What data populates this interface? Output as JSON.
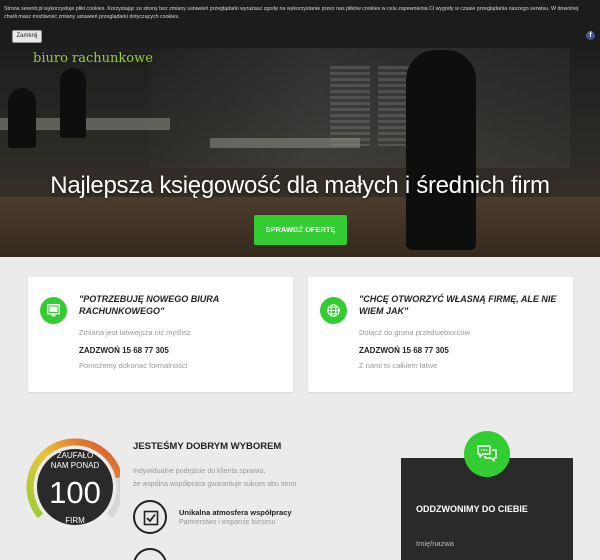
{
  "cookie": {
    "text": "Strona serenit.pl wykorzystuje pliki cookies. Korzystając ze strony bez zmiany ustawień przeglądarki wyrażasz zgodę na wykorzystanie przez nas plików cookies w celu zapewnienia Ci wygody w czasie przeglądania naszego serwisu. W dowolnej chwili masz możliwość zmiany ustawień przeglądarki dotyczących cookies.",
    "close_label": "Zamknij",
    "social_icon": "f"
  },
  "hero": {
    "brand": "biuro rachunkowe",
    "headline": "Najlepsza księgowość dla małych i średnich firm",
    "cta_label": "SPRAWDŹ OFERTĘ"
  },
  "cards": [
    {
      "icon": "computer-icon",
      "title": "\"POTRZEBUJĘ NOWEGO BIURA RACHUNKOWEGO\"",
      "subtitle": "Zmiana jest łatwiejsza niż myślisz",
      "phone": "ZADZWOŃ 15 68 77 305",
      "note": "Pomożemy dokonać formalności"
    },
    {
      "icon": "globe-icon",
      "title": "\"CHCĘ OTWORZYĆ WŁASNĄ FIRMĘ, ALE NIE WIEM JAK\"",
      "subtitle": "Dołącz do grona przedsiębiorców",
      "phone": "ZADZWOŃ 15 68 77 305",
      "note": "Z nami to całkiem łatwe"
    }
  ],
  "trust": {
    "line1": "ZAUFAŁO",
    "line2": "NAM PONAD",
    "number": "100",
    "line3": "FIRM",
    "gauge_level": 0.8
  },
  "why": {
    "title": "JESTEŚMY DOBRYM WYBOREM",
    "text_lines": [
      "Indywidualne podejście do klienta sprawia,",
      "że wspólna współpraca gwarantuje sukces obu stron"
    ],
    "feature_title": "Unikalna atmosfera współpracy",
    "feature_sub": "Partnerstwo i wsparcie biznesu"
  },
  "callback": {
    "title": "ODDZWONIMY DO CIEBIE",
    "name_placeholder": "Imię/nazwa"
  },
  "colors": {
    "accent": "#33cc33",
    "brand_text": "#9acd32",
    "dark_panel": "#2a2a2a",
    "cookie_bg": "#1c1c1c"
  }
}
